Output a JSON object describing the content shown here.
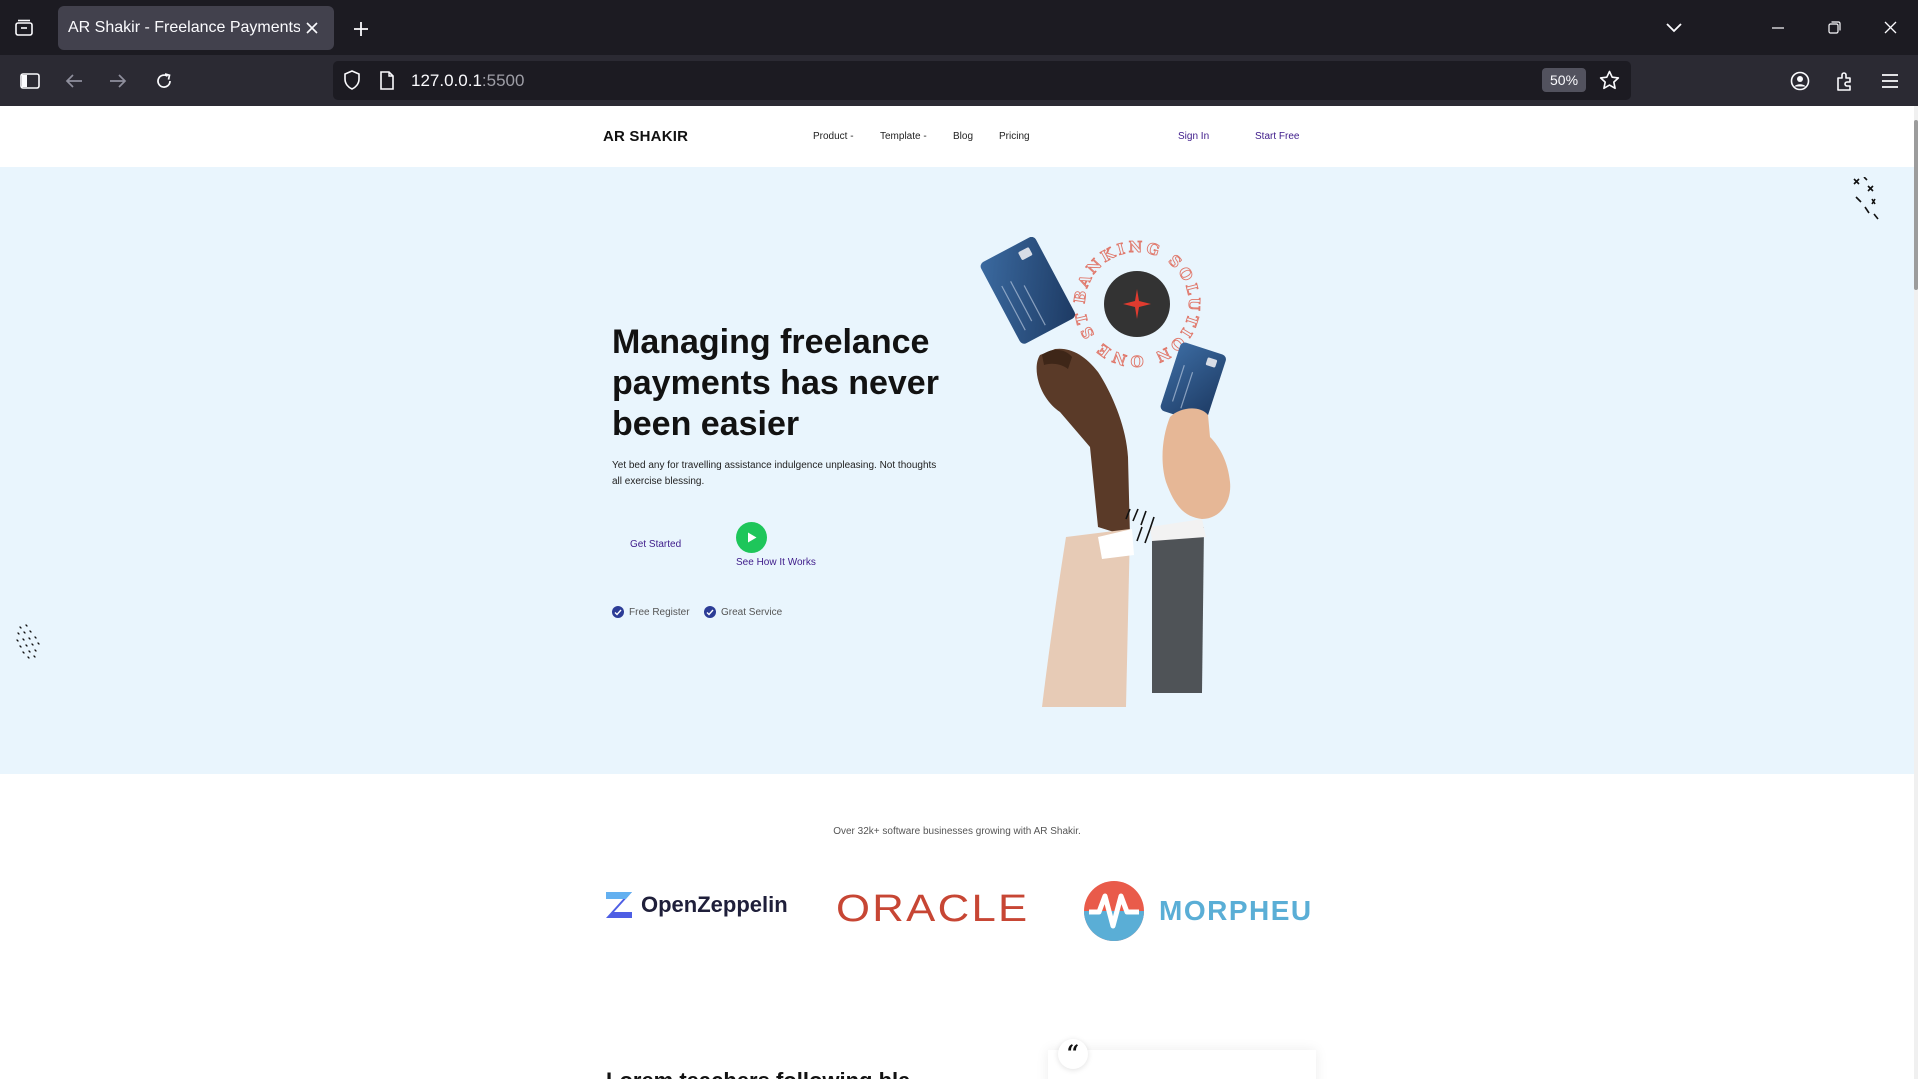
{
  "browser": {
    "tab_title": "AR Shakir - Freelance Payments",
    "url_host": "127.0.0.1",
    "url_port": ":5500",
    "zoom": "50%"
  },
  "header": {
    "logo": "AR SHAKIR",
    "menu": [
      "Product",
      "Template",
      "Blog",
      "Pricing"
    ],
    "menu_dropdown_suffix": "-",
    "sign_in": "Sign In",
    "start_free": "Start Free"
  },
  "hero": {
    "title": "Managing freelance payments has never been easier",
    "subtitle": "Yet bed any for travelling assistance indulgence unpleasing. Not thoughts all exercise blessing.",
    "cta_primary": "Get Started",
    "cta_secondary": "See How It Works",
    "perks": [
      "Free Register",
      "Great Service"
    ],
    "badge_text": "BANKING SOLUTION ONE STOP",
    "colors": {
      "background": "#e9f5fd",
      "accent_purple": "#3e1b8a",
      "play_green": "#1ec65a",
      "check_navy": "#2c3c96"
    }
  },
  "partners": {
    "caption": "Over 32k+ software businesses growing with AR Shakir.",
    "brands": [
      "OpenZeppelin",
      "ORACLE",
      "MORPHEU"
    ],
    "colors": {
      "oracle_red": "#c74634",
      "morpheu_blue": "#5aaed6",
      "openzeppelin_blue": "#4e5ee4"
    }
  },
  "testimonial": {
    "quote_mark": "“",
    "heading_partial": "Lorem teachers following bla"
  },
  "icons": [
    "tab-list-icon",
    "close-icon",
    "plus-icon",
    "chevron-down-icon",
    "minimize-icon",
    "restore-icon",
    "sidebar-icon",
    "back-arrow-icon",
    "forward-arrow-icon",
    "reload-icon",
    "shield-icon",
    "page-icon",
    "star-icon",
    "account-icon",
    "extensions-icon",
    "menu-icon",
    "play-icon",
    "check-icon"
  ]
}
